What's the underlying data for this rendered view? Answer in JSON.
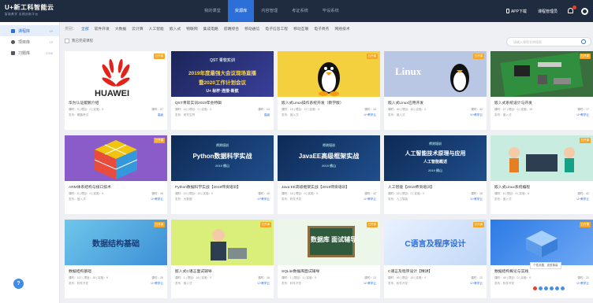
{
  "app": {
    "logo_main": "U+新工科智能云",
    "logo_sub": "智能教学 实践创新平台"
  },
  "nav": [
    {
      "label": "我的课堂"
    },
    {
      "label": "资源库",
      "active": true
    },
    {
      "label": "内容管理"
    },
    {
      "label": "考证系统"
    },
    {
      "label": "毕设系统"
    }
  ],
  "topbar": {
    "app_download": "APP下载",
    "user": "课程管理员"
  },
  "sidebar": [
    {
      "label": "课程库",
      "count": "69",
      "active": true
    },
    {
      "label": "项目库",
      "count": "15"
    },
    {
      "label": "习题库",
      "count": "2336"
    }
  ],
  "filter": {
    "label": "类别：",
    "tags": [
      "全部",
      "软件开发",
      "大数据",
      "云计算",
      "人工智能",
      "嵌入式",
      "物联网",
      "集成电路",
      "前端综合",
      "移动通信",
      "电子信息工程",
      "移动互联",
      "电子商务",
      "网络技术"
    ],
    "active_index": 0
  },
  "toolbar": {
    "checkbox_label": "我已完成课程",
    "search_placeholder": "请输入课程名称搜索"
  },
  "cards": [
    {
      "badge": "已开课",
      "title": "华为认证鲲鹏介绍",
      "thumb_title": "",
      "meta": "课时：9 | 项目：0 | 实验：9",
      "meta_r": "课时：37",
      "m2": "发布：鲲鹏考试",
      "m2_r": "高级"
    },
    {
      "badge": "",
      "title": "QST青软实训2019年会特辑",
      "thumb_title": "2019年度最强大会议现场直播",
      "meta": "课时：12 | 项目：0 | 实验：0",
      "meta_r": "课时：24",
      "m2": "发布：研究生院",
      "m2_r": "高级"
    },
    {
      "badge": "已开课",
      "title": "嵌入式Linux操作系统开发（教学版）",
      "thumb_title": "",
      "meta": "课时：15 | 项目：17 | 实验：0",
      "meta_r": "课时：44",
      "m2": "发布：嵌入式",
      "m2_r": "U+教学云"
    },
    {
      "badge": "已开课",
      "title": "嵌入式Linux应用开发",
      "thumb_title": "Linux",
      "meta": "课时：40 | 项目：20 | 实验：0",
      "meta_r": "课时：42",
      "m2": "发布：嵌入式",
      "m2_r": "U+教学云"
    },
    {
      "badge": "已开课",
      "title": "嵌入式系统设计与开发",
      "thumb_title": "",
      "meta": "课时：27 | 项目：0 | 实验：19",
      "meta_r": "课时：17",
      "m2": "发布：嵌入式",
      "m2_r": "U+教学云"
    },
    {
      "badge": "已开课",
      "title": "ARM体系结构与接口技术",
      "thumb_title": "",
      "meta": "课时：8 | 项目：0 | 实验：5",
      "meta_r": "课时：40",
      "m2": "发布：嵌入式",
      "m2_r": "U+教学云"
    },
    {
      "badge": "已开课",
      "title": "Python数据科学实战【2019师资培训】",
      "thumb_title": "Python数据科学实战",
      "meta": "课时：10 | 项目：15 | 实验：0",
      "meta_r": "课时：45",
      "m2": "发布：大数据",
      "m2_r": "U+教学云"
    },
    {
      "badge": "已开课",
      "title": "Java EE高级框架实战【2019师资培训】",
      "thumb_title": "JavaEE高级框架实战",
      "meta": "课时：16 | 项目：0 | 实验：0",
      "meta_r": "课时：42",
      "m2": "发布：软件开发",
      "m2_r": "U+教学云"
    },
    {
      "badge": "已开课",
      "title": "人工智能【2019师资培训】",
      "thumb_title": "人工智能技术原理与应用",
      "meta": "课时：20 | 项目：0 | 实验：0",
      "meta_r": "课时：26",
      "m2": "发布：人工智能",
      "m2_r": "U+教学云"
    },
    {
      "badge": "已开课",
      "title": "嵌入式Linux系统编程",
      "thumb_title": "",
      "meta": "课时：8 | 项目：0 | 实验：0",
      "meta_r": "课时：42",
      "m2": "发布：嵌入式",
      "m2_r": "U+教学云"
    },
    {
      "badge": "已开课",
      "title": "数据结构基础",
      "thumb_title": "数据结构基础",
      "meta": "课时：117 | 项目：15 | 实验：9",
      "meta_r": "课时：26",
      "m2": "发布：软件开发",
      "m2_r": "U+教学云"
    },
    {
      "badge": "已开课",
      "title": "嵌入式C语言面试辅导",
      "thumb_title": "",
      "meta": "课时：1 | 项目：16 | 实验：0",
      "meta_r": "课时：18",
      "m2": "发布：嵌入式",
      "m2_r": "U+教学云"
    },
    {
      "badge": "已开课",
      "title": "SQLite数据库面试辅导",
      "thumb_title": "数据库 面试辅导",
      "meta": "课时：1 | 项目：1 | 实验：0",
      "meta_r": "课时：13",
      "m2": "发布：软件开发",
      "m2_r": "U+教学云"
    },
    {
      "badge": "已开课",
      "title": "C语言及程序设计【精讲】",
      "thumb_title": "C语言及程序设计",
      "meta": "课时：90 | 项目：15 | 实验：0",
      "meta_r": "课时：22",
      "m2": "发布：软件开发",
      "m2_r": "U+教学云"
    },
    {
      "badge": "已开课",
      "title": "数据结构概论与实践",
      "thumb_title": "",
      "meta": "课时：40 | 项目：0 | 实验：0",
      "meta_r": "课时：22",
      "m2": "发布：软件开发",
      "m2_r": "U+教学云"
    }
  ],
  "tooltip": "个性设置、皮肤换装"
}
